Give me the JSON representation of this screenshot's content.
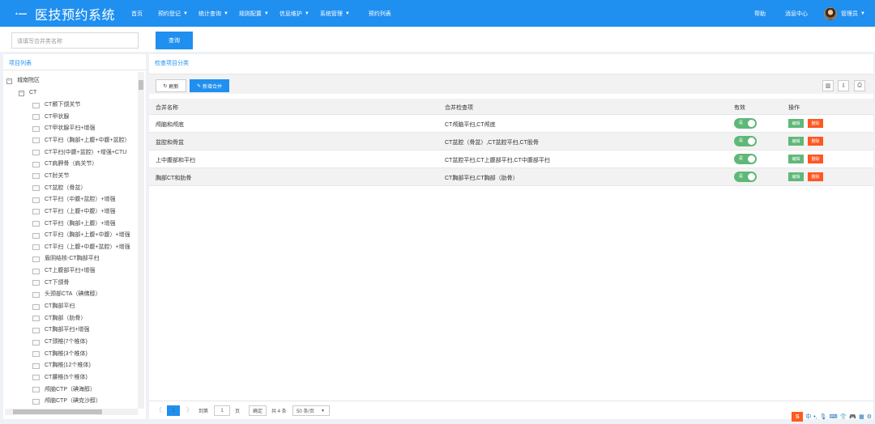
{
  "app": {
    "brand": "医技预约系统"
  },
  "nav": [
    {
      "label": "首页",
      "caret": false
    },
    {
      "label": "预约登记",
      "caret": true
    },
    {
      "label": "统计查询",
      "caret": true
    },
    {
      "label": "规则配置",
      "caret": true
    },
    {
      "label": "信息维护",
      "caret": true
    },
    {
      "label": "系统管理",
      "caret": true
    },
    {
      "label": "预约列表",
      "caret": false
    }
  ],
  "right_nav": {
    "help": "帮助",
    "messages": "消息中心",
    "user": "管理员"
  },
  "search": {
    "placeholder": "请填写合并类名称",
    "button": "查询"
  },
  "left_panel": {
    "title": "项目列表",
    "root": "城南院区",
    "group": "CT",
    "items": [
      "CT颞下颌关节",
      "CT甲状腺",
      "CT甲状腺平扫+增强",
      "CT平扫（胸部+上腹+中腹+盆腔）",
      "CT平扫(中腹+盆腔）+增强+CTU",
      "CT肩胛骨（肩关节）",
      "CT肘关节",
      "CT盆腔（骨盆）",
      "CT平扫（中腹+盆腔）+增强",
      "CT平扫（上腹+中腹）+增强",
      "CT平扫（胸部+上腹）+增强",
      "CT平扫（胸部+上腹+中腹）+增强",
      "CT平扫（上腹+中腹+盆腔）+增强",
      "盾阴结核-CT胸部平扫",
      "CT上腹部平扫+增强",
      "CT下颌骨",
      "头颈部CTA（碘佛醇）",
      "CT胸部平扫",
      "CT胸部（肋骨）",
      "CT胸部平扫+增强",
      "CT颈椎(7个椎体)",
      "CT胸椎(3个椎体)",
      "CT胸椎(12个椎体)",
      "CT腰椎(5个椎体)",
      "颅脑CTP（碘海醇）",
      "颅脑CTP（碘克沙醇）"
    ]
  },
  "right_panel": {
    "title": "检查项目分类",
    "refresh": "刷新",
    "add": "新增合并",
    "columns": [
      "合并名称",
      "合并检查项",
      "有效",
      "操作"
    ],
    "rows": [
      {
        "name": "颅脑和颅底",
        "items": "CT颅脑平扫,CT颅底",
        "valid": "是"
      },
      {
        "name": "盆腔和骨盆",
        "items": "CT盆腔（骨盆）,CT盆腔平扫,CT股骨",
        "valid": "是"
      },
      {
        "name": "上中腹部和平扫",
        "items": "CT盆腔平扫,CT上腹部平扫,CT中腹部平扫",
        "valid": "是"
      },
      {
        "name": "胸部CT和肋骨",
        "items": "CT胸部平扫,CT胸部（肋骨）",
        "valid": "是"
      }
    ],
    "edit": "编辑",
    "delete": "删除"
  },
  "pager": {
    "prev": "〈",
    "current": "1",
    "next": "〉",
    "goto_label": "到第",
    "page_input": "1",
    "page_unit": "页",
    "confirm": "确定",
    "total": "共 4 条",
    "per_page": "50 条/页"
  },
  "tray": {
    "ime": "S",
    "lang": "中"
  },
  "colors": {
    "primary": "#1f8ff0",
    "success": "#5fb878",
    "danger": "#ff5722"
  }
}
